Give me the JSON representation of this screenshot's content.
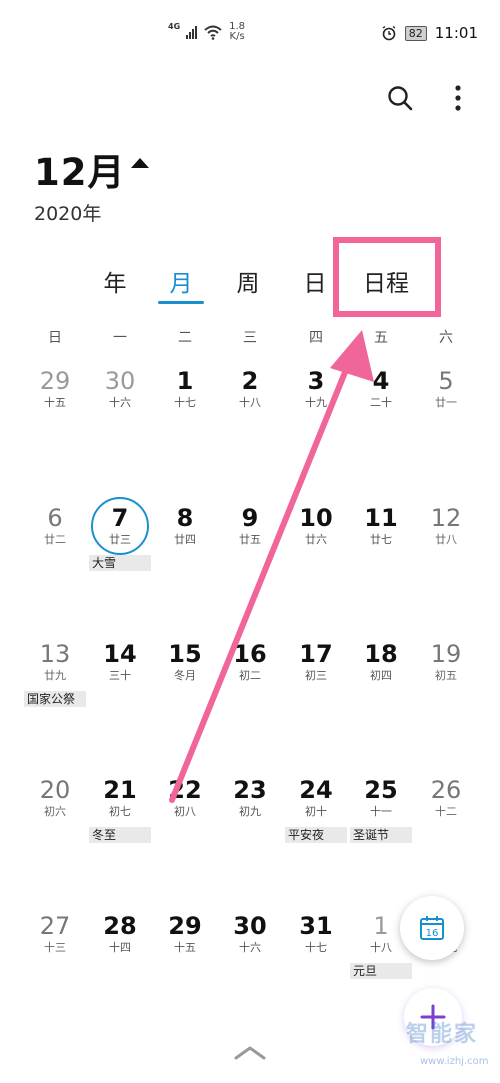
{
  "status_bar": {
    "network_type": "4G",
    "speed_value": "1.8",
    "speed_unit": "K/s",
    "battery": "82",
    "time": "11:01"
  },
  "header": {
    "month": "12月",
    "year": "2020年"
  },
  "view_tabs": [
    {
      "label": "年",
      "active": false
    },
    {
      "label": "月",
      "active": true
    },
    {
      "label": "周",
      "active": false
    },
    {
      "label": "日",
      "active": false
    },
    {
      "label": "日程",
      "active": false
    }
  ],
  "weekdays": [
    "日",
    "一",
    "二",
    "三",
    "四",
    "五",
    "六"
  ],
  "weeks": [
    [
      {
        "day": "29",
        "lunar": "十五",
        "muted": true
      },
      {
        "day": "30",
        "lunar": "十六",
        "muted": true
      },
      {
        "day": "1",
        "lunar": "十七"
      },
      {
        "day": "2",
        "lunar": "十八"
      },
      {
        "day": "3",
        "lunar": "十九"
      },
      {
        "day": "4",
        "lunar": "二十"
      },
      {
        "day": "5",
        "lunar": "廿一"
      }
    ],
    [
      {
        "day": "6",
        "lunar": "廿二"
      },
      {
        "day": "7",
        "lunar": "廿三",
        "today": true
      },
      {
        "day": "8",
        "lunar": "廿四"
      },
      {
        "day": "9",
        "lunar": "廿五"
      },
      {
        "day": "10",
        "lunar": "廿六"
      },
      {
        "day": "11",
        "lunar": "廿七"
      },
      {
        "day": "12",
        "lunar": "廿八"
      }
    ],
    [
      {
        "day": "13",
        "lunar": "廿九"
      },
      {
        "day": "14",
        "lunar": "三十"
      },
      {
        "day": "15",
        "lunar": "冬月"
      },
      {
        "day": "16",
        "lunar": "初二"
      },
      {
        "day": "17",
        "lunar": "初三"
      },
      {
        "day": "18",
        "lunar": "初四"
      },
      {
        "day": "19",
        "lunar": "初五"
      }
    ],
    [
      {
        "day": "20",
        "lunar": "初六"
      },
      {
        "day": "21",
        "lunar": "初七"
      },
      {
        "day": "22",
        "lunar": "初八"
      },
      {
        "day": "23",
        "lunar": "初九"
      },
      {
        "day": "24",
        "lunar": "初十"
      },
      {
        "day": "25",
        "lunar": "十一"
      },
      {
        "day": "26",
        "lunar": "十二"
      }
    ],
    [
      {
        "day": "27",
        "lunar": "十三"
      },
      {
        "day": "28",
        "lunar": "十四"
      },
      {
        "day": "29",
        "lunar": "十五"
      },
      {
        "day": "30",
        "lunar": "十六"
      },
      {
        "day": "31",
        "lunar": "十七"
      },
      {
        "day": "1",
        "lunar": "十八",
        "muted": true
      },
      {
        "day": "2",
        "lunar": "十九",
        "muted": true
      }
    ]
  ],
  "events": [
    {
      "week": 1,
      "col": 1,
      "label": "大雪"
    },
    {
      "week": 2,
      "col": 0,
      "label": "国家公祭"
    },
    {
      "week": 3,
      "col": 1,
      "label": "冬至"
    },
    {
      "week": 3,
      "col": 4,
      "label": "平安夜"
    },
    {
      "week": 3,
      "col": 5,
      "label": "圣诞节"
    },
    {
      "week": 4,
      "col": 5,
      "label": "元旦"
    }
  ],
  "today_button_label": "16",
  "watermark": "智能家",
  "watermark_sub": "www.izhj.com",
  "colors": {
    "accent": "#1a8fd0",
    "annotation": "#f0669b",
    "add_button": "#7b3fd1"
  },
  "icons": {
    "search": "search-icon",
    "more": "more-vertical-icon",
    "month_toggle": "triangle-up-icon",
    "today": "calendar-today-icon",
    "add": "plus-icon",
    "expand": "chevron-up-icon"
  }
}
